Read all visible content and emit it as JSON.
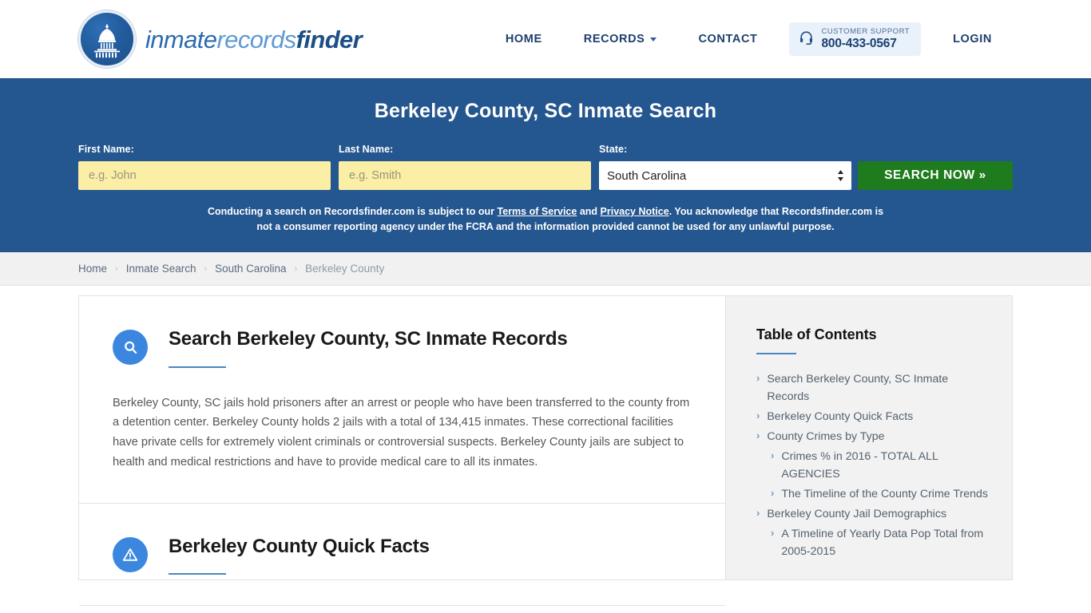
{
  "header": {
    "brand": {
      "part1": "inmate",
      "part2": "records",
      "part3": "finder",
      "emblem_icon": "capitol-dome-icon"
    },
    "nav": [
      {
        "label": "HOME",
        "name": "nav-home"
      },
      {
        "label": "RECORDS",
        "name": "nav-records",
        "has_caret": true
      },
      {
        "label": "CONTACT",
        "name": "nav-contact"
      }
    ],
    "support": {
      "icon": "headset-icon",
      "label": "CUSTOMER SUPPORT",
      "phone": "800-433-0567"
    },
    "login_label": "LOGIN"
  },
  "hero": {
    "title": "Berkeley County, SC Inmate Search",
    "first_name": {
      "label": "First Name:",
      "value": "",
      "placeholder": "e.g. John"
    },
    "last_name": {
      "label": "Last Name:",
      "value": "",
      "placeholder": "e.g. Smith"
    },
    "state": {
      "label": "State:",
      "selected": "South Carolina",
      "options": [
        "South Carolina"
      ]
    },
    "search_button": "SEARCH NOW »",
    "disclaimer": {
      "part1": "Conducting a search on Recordsfinder.com is subject to our ",
      "link1": "Terms of Service",
      "part2": " and ",
      "link2": "Privacy Notice",
      "part3": ". You acknowledge that Recordsfinder.com is not a consumer reporting agency under the FCRA and the information provided cannot be used for any unlawful purpose."
    },
    "bg_color": "#24568f",
    "button_color": "#1e7b1e",
    "input_color": "#fbeea5"
  },
  "breadcrumb": {
    "separator": "›",
    "items": [
      {
        "label": "Home",
        "current": false
      },
      {
        "label": "Inmate Search",
        "current": false
      },
      {
        "label": "South Carolina",
        "current": false
      },
      {
        "label": "Berkeley County",
        "current": true
      }
    ]
  },
  "main": {
    "sections": [
      {
        "icon": "magnifier-icon",
        "title": "Search Berkeley County, SC Inmate Records",
        "paragraph": "Berkeley County, SC jails hold prisoners after an arrest or people who have been transferred to the county from a detention center. Berkeley County holds 2 jails with a total of 134,415 inmates. These correctional facilities have private cells for extremely violent criminals or controversial suspects. Berkeley County jails are subject to health and medical restrictions and have to provide medical care to all its inmates."
      },
      {
        "icon": "warning-triangle-icon",
        "title": "Berkeley County Quick Facts",
        "paragraph": ""
      }
    ]
  },
  "toc": {
    "title": "Table of Contents",
    "bullet": "›",
    "items": [
      {
        "label": "Search Berkeley County, SC Inmate Records",
        "sub": false
      },
      {
        "label": "Berkeley County Quick Facts",
        "sub": false
      },
      {
        "label": "County Crimes by Type",
        "sub": false
      },
      {
        "label": "Crimes % in 2016 - TOTAL ALL AGENCIES",
        "sub": true
      },
      {
        "label": "The Timeline of the County Crime Trends",
        "sub": true
      },
      {
        "label": "Berkeley County Jail Demographics",
        "sub": false
      },
      {
        "label": "A Timeline of Yearly Data Pop Total from 2005-2015",
        "sub": true
      }
    ]
  }
}
